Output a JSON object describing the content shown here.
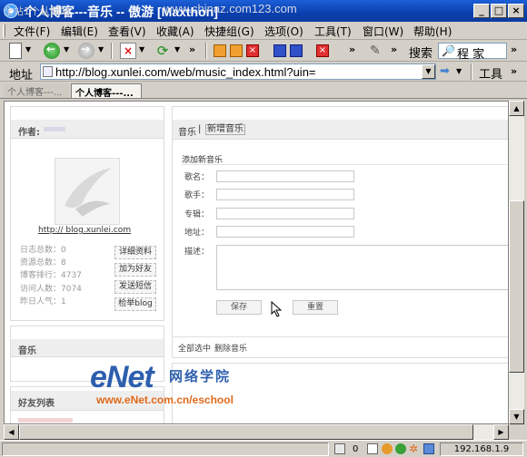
{
  "window": {
    "title": "个人博客---音乐 -- 傲游 [Maxthon]",
    "watermark_top": "www.chinaz.com123.com",
    "watermark_left": "全站1个认网站"
  },
  "menu": [
    "文件(F)",
    "编辑(E)",
    "查看(V)",
    "收藏(A)",
    "快捷组(G)",
    "选项(O)",
    "工具(T)",
    "窗口(W)",
    "帮助(H)"
  ],
  "toolbar": {
    "search_label": "搜索",
    "search_value": "程 家"
  },
  "address": {
    "label": "地址",
    "url": "http://blog.xunlei.com/web/music_index.html?uin=",
    "tools_label": "工具"
  },
  "tabs": [
    {
      "label": "个人博客---..."
    },
    {
      "label": "个人博客---..."
    }
  ],
  "sidebar": {
    "author_label": "作者:",
    "blog_link": "http://      blog.xunlei.com",
    "stats": [
      "日志总数：0",
      "资源总数：8",
      "博客排行：4737",
      "访问人数：7074",
      "昨日人气：1"
    ],
    "buttons": [
      "详细资料",
      "加为好友",
      "发送短信",
      "检举blog"
    ],
    "music_header": "音乐",
    "friends_header": "好友列表"
  },
  "main": {
    "tab_music": "音乐",
    "tab_sep": "|",
    "tab_add": "新增音乐",
    "section_title": "添加新音乐",
    "fields": [
      {
        "label": "歌名："
      },
      {
        "label": "歌手："
      },
      {
        "label": "专辑："
      },
      {
        "label": "地址："
      },
      {
        "label": "描述："
      }
    ],
    "save_button": "保存",
    "reset_button": "重置",
    "select_all": "全部选中",
    "delete_music": "删除音乐"
  },
  "watermark": {
    "logo": "eNet",
    "cn": "网络学院",
    "url": "www.eNet.com.cn/eschool"
  },
  "statusbar": {
    "count": "0",
    "ip": "192.168.1.9"
  }
}
